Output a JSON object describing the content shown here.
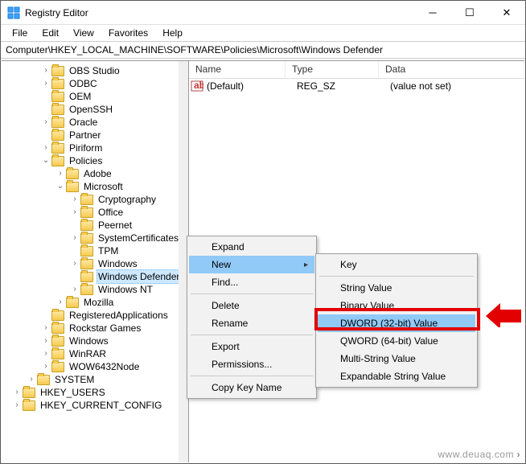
{
  "window": {
    "title": "Registry Editor"
  },
  "menubar": [
    "File",
    "Edit",
    "View",
    "Favorites",
    "Help"
  ],
  "address": "Computer\\HKEY_LOCAL_MACHINE\\SOFTWARE\\Policies\\Microsoft\\Windows Defender",
  "tree": {
    "i0": "OBS Studio",
    "i1": "ODBC",
    "i2": "OEM",
    "i3": "OpenSSH",
    "i4": "Oracle",
    "i5": "Partner",
    "i6": "Piriform",
    "i7": "Policies",
    "i8": "Adobe",
    "i9": "Microsoft",
    "i10": "Cryptography",
    "i11": "Office",
    "i12": "Peernet",
    "i13": "SystemCertificates",
    "i14": "TPM",
    "i15": "Windows",
    "i16": "Windows Defender",
    "i17": "Windows NT",
    "i18": "Mozilla",
    "i19": "RegisteredApplications",
    "i20": "Rockstar Games",
    "i21": "Windows",
    "i22": "WinRAR",
    "i23": "WOW6432Node",
    "i24": "SYSTEM",
    "i25": "HKEY_USERS",
    "i26": "HKEY_CURRENT_CONFIG"
  },
  "list": {
    "headers": {
      "name": "Name",
      "type": "Type",
      "data": "Data"
    },
    "rows": [
      {
        "name": "(Default)",
        "type": "REG_SZ",
        "data": "(value not set)"
      }
    ]
  },
  "ctx1": {
    "expand": "Expand",
    "new": "New",
    "find": "Find...",
    "delete": "Delete",
    "rename": "Rename",
    "export": "Export",
    "permissions": "Permissions...",
    "copy": "Copy Key Name"
  },
  "ctx2": {
    "key": "Key",
    "string": "String Value",
    "binary": "Binary Value",
    "dword": "DWORD (32-bit) Value",
    "qword": "QWORD (64-bit) Value",
    "multi": "Multi-String Value",
    "expand": "Expandable String Value"
  },
  "watermark": "www.deuaq.com"
}
